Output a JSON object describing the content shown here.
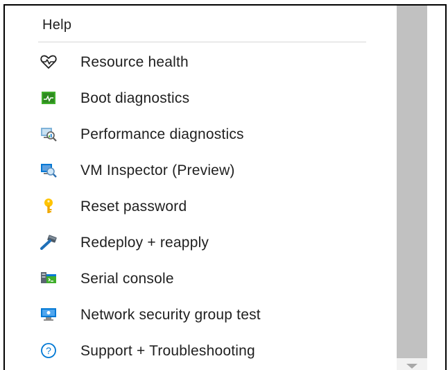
{
  "section": {
    "title": "Help"
  },
  "menu": {
    "items": [
      {
        "label": "Resource health",
        "icon": "heart-pulse-icon"
      },
      {
        "label": "Boot diagnostics",
        "icon": "boot-diagnostics-icon"
      },
      {
        "label": "Performance diagnostics",
        "icon": "performance-diagnostics-icon"
      },
      {
        "label": "VM Inspector (Preview)",
        "icon": "vm-inspector-icon"
      },
      {
        "label": "Reset password",
        "icon": "key-icon"
      },
      {
        "label": "Redeploy + reapply",
        "icon": "hammer-icon"
      },
      {
        "label": "Serial console",
        "icon": "serial-console-icon"
      },
      {
        "label": "Network security group test",
        "icon": "network-monitor-icon"
      },
      {
        "label": "Support + Troubleshooting",
        "icon": "question-icon"
      }
    ]
  },
  "colors": {
    "accent": "#0078d4",
    "boot_green": "#3fae2a",
    "key_yellow": "#ffc400",
    "scroll_thumb": "#c1c1c1"
  }
}
